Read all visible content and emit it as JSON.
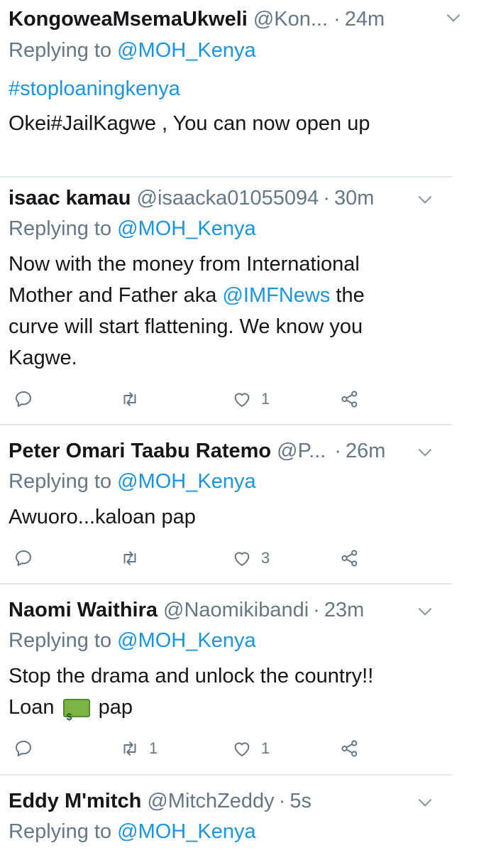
{
  "colors": {
    "text": "#14171a",
    "muted": "#657786",
    "link": "#1b95e0",
    "divider": "#e1e8ed"
  },
  "tweets": [
    {
      "name": "KongoweaMsemaUkweli",
      "handle": "@Kon...",
      "sep": "·",
      "time": "24m",
      "reply_prefix": "Replying to ",
      "reply_to": "@MOH_Kenya",
      "hashtag": "#stoploaningkenya",
      "text": "Okei#JailKagwe , You can now open up"
    },
    {
      "name": "isaac kamau",
      "handle": "@isaacka01055094",
      "sep": "·",
      "time": "30m",
      "reply_prefix": "Replying to ",
      "reply_to": "@MOH_Kenya",
      "text_a": "Now with the money from International Mother and Father aka ",
      "mention": "@IMFNews",
      "text_b": " the curve will start flattening. We know you Kagwe.",
      "retweets": "",
      "likes": "1"
    },
    {
      "name": "Peter Omari Taabu Ratemo",
      "handle": "@P...",
      "sep": "·",
      "time": "26m",
      "reply_prefix": "Replying to ",
      "reply_to": "@MOH_Kenya",
      "text": "Awuoro...kaloan pap",
      "retweets": "",
      "likes": "3"
    },
    {
      "name": "Naomi Waithira",
      "handle": "@Naomikibandi",
      "sep": "·",
      "time": "23m",
      "reply_prefix": "Replying to ",
      "reply_to": "@MOH_Kenya",
      "text_a": "Stop the drama and unlock the country!!",
      "text_b1": "Loan",
      "emoji": "money-icon",
      "emoji_symbol": "$",
      "text_b2": " pap",
      "retweets": "1",
      "likes": "1"
    },
    {
      "name": "Eddy M'mitch",
      "handle": "@MitchZeddy",
      "sep": "·",
      "time": "5s",
      "reply_prefix": "Replying to ",
      "reply_to": "@MOH_Kenya"
    }
  ]
}
